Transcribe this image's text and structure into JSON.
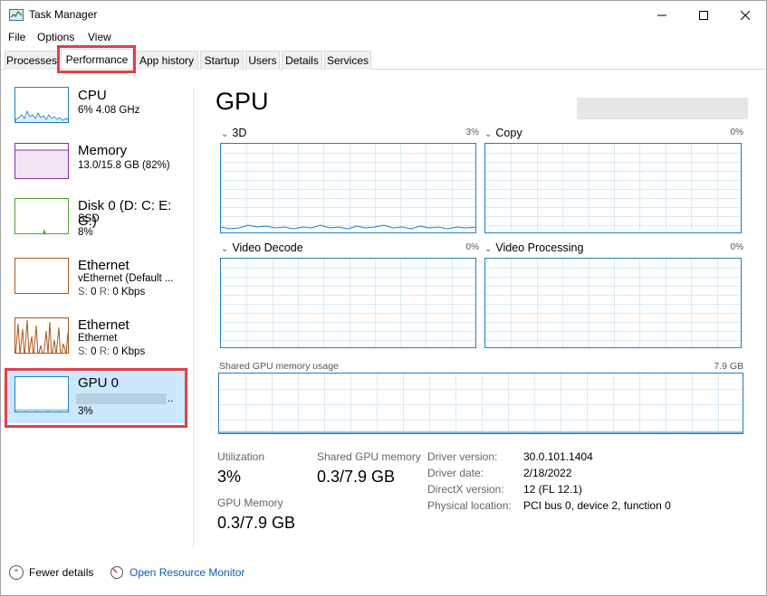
{
  "window": {
    "title": "Task Manager"
  },
  "menu": [
    "File",
    "Options",
    "View"
  ],
  "tabs": [
    "Processes",
    "Performance",
    "App history",
    "Startup",
    "Users",
    "Details",
    "Services"
  ],
  "active_tab": "Performance",
  "sidebar": {
    "items": [
      {
        "title": "CPU",
        "line1": "6% 4.08 GHz",
        "line2": "",
        "color": "#1e7fc1"
      },
      {
        "title": "Memory",
        "line1": "13.0/15.8 GB (82%)",
        "line2": "",
        "color": "#8b2ea0"
      },
      {
        "title": "Disk 0 (D: C: E: G:)",
        "line1": "SSD",
        "line2": "8%",
        "color": "#4da233"
      },
      {
        "title": "Ethernet",
        "line1": "vEthernet (Default ...",
        "line2_s": "S:",
        "line2_sv": "0",
        "line2_r": "R:",
        "line2_rv": "0 Kbps",
        "color": "#a7571a"
      },
      {
        "title": "Ethernet",
        "line1": "Ethernet",
        "line2_s": "S:",
        "line2_sv": "0",
        "line2_r": "R:",
        "line2_rv": "0 Kbps",
        "color": "#a7571a"
      },
      {
        "title": "GPU 0",
        "line1": "..",
        "line2": "3%",
        "color": "#1e7fc1"
      }
    ]
  },
  "main": {
    "title": "GPU",
    "graphs": [
      {
        "label": "3D",
        "pct": "3%"
      },
      {
        "label": "Copy",
        "pct": "0%"
      },
      {
        "label": "Video Decode",
        "pct": "0%"
      },
      {
        "label": "Video Processing",
        "pct": "0%"
      }
    ],
    "shared": {
      "label": "Shared GPU memory usage",
      "max": "7.9 GB"
    },
    "stats": {
      "utilization_label": "Utilization",
      "utilization_value": "3%",
      "shared_label": "Shared GPU memory",
      "shared_value": "0.3/7.9 GB",
      "gpumem_label": "GPU Memory",
      "gpumem_value": "0.3/7.9 GB"
    },
    "info": {
      "driver_version_key": "Driver version:",
      "driver_version_val": "30.0.101.1404",
      "driver_date_key": "Driver date:",
      "driver_date_val": "2/18/2022",
      "directx_key": "DirectX version:",
      "directx_val": "12 (FL 12.1)",
      "location_key": "Physical location:",
      "location_val": "PCI bus 0, device 2, function 0"
    }
  },
  "footer": {
    "fewer_details": "Fewer details",
    "open_resmon": "Open Resource Monitor"
  },
  "colors": {
    "accent": "#1f7fbf",
    "highlight": "#e0404a",
    "selected_bg": "#cce8ff"
  }
}
